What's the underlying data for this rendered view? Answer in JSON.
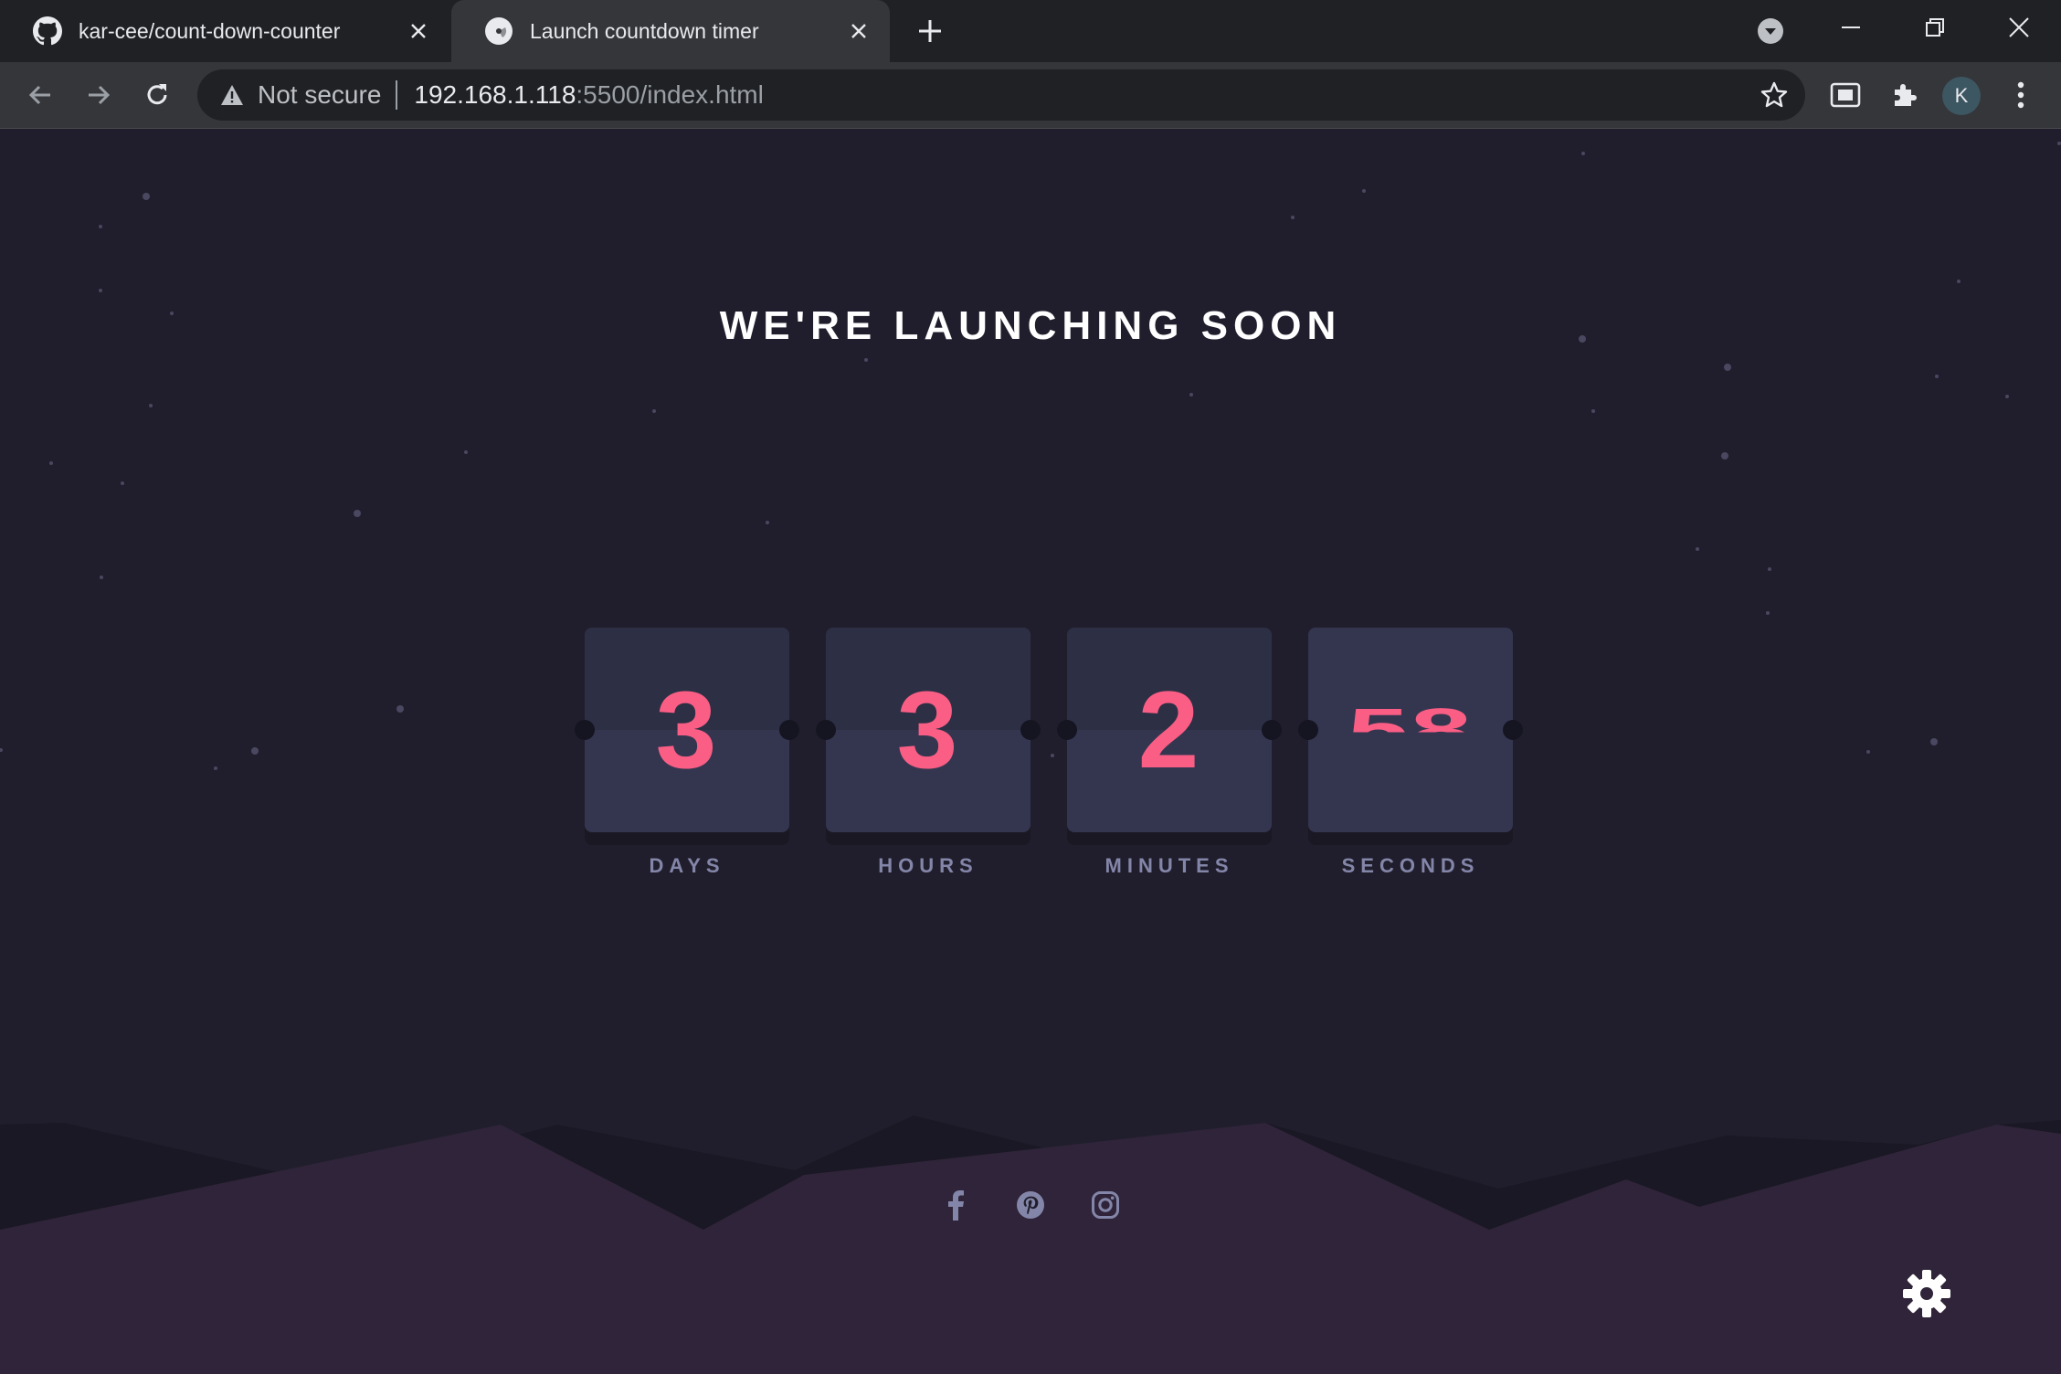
{
  "browser": {
    "tabs": [
      {
        "title": "kar-cee/count-down-counter",
        "favicon": "github-icon",
        "active": false
      },
      {
        "title": "Launch countdown timer",
        "favicon": "page-icon",
        "active": true
      }
    ],
    "address": {
      "security_label": "Not secure",
      "host": "192.168.1.118",
      "path": ":5500/index.html"
    },
    "profile_initial": "K"
  },
  "page": {
    "headline": "WE'RE LAUNCHING SOON",
    "countdown": [
      {
        "value": "3",
        "label": "DAYS"
      },
      {
        "value": "3",
        "label": "HOURS"
      },
      {
        "value": "2",
        "label": "MINUTES"
      },
      {
        "value": "58",
        "label": "SECONDS"
      }
    ],
    "social": [
      "facebook-icon",
      "pinterest-icon",
      "instagram-icon"
    ],
    "colors": {
      "background": "#201e2c",
      "card": "#343650",
      "number": "#fb5e84",
      "label": "#8486a9",
      "hills": "#2f2439"
    }
  }
}
